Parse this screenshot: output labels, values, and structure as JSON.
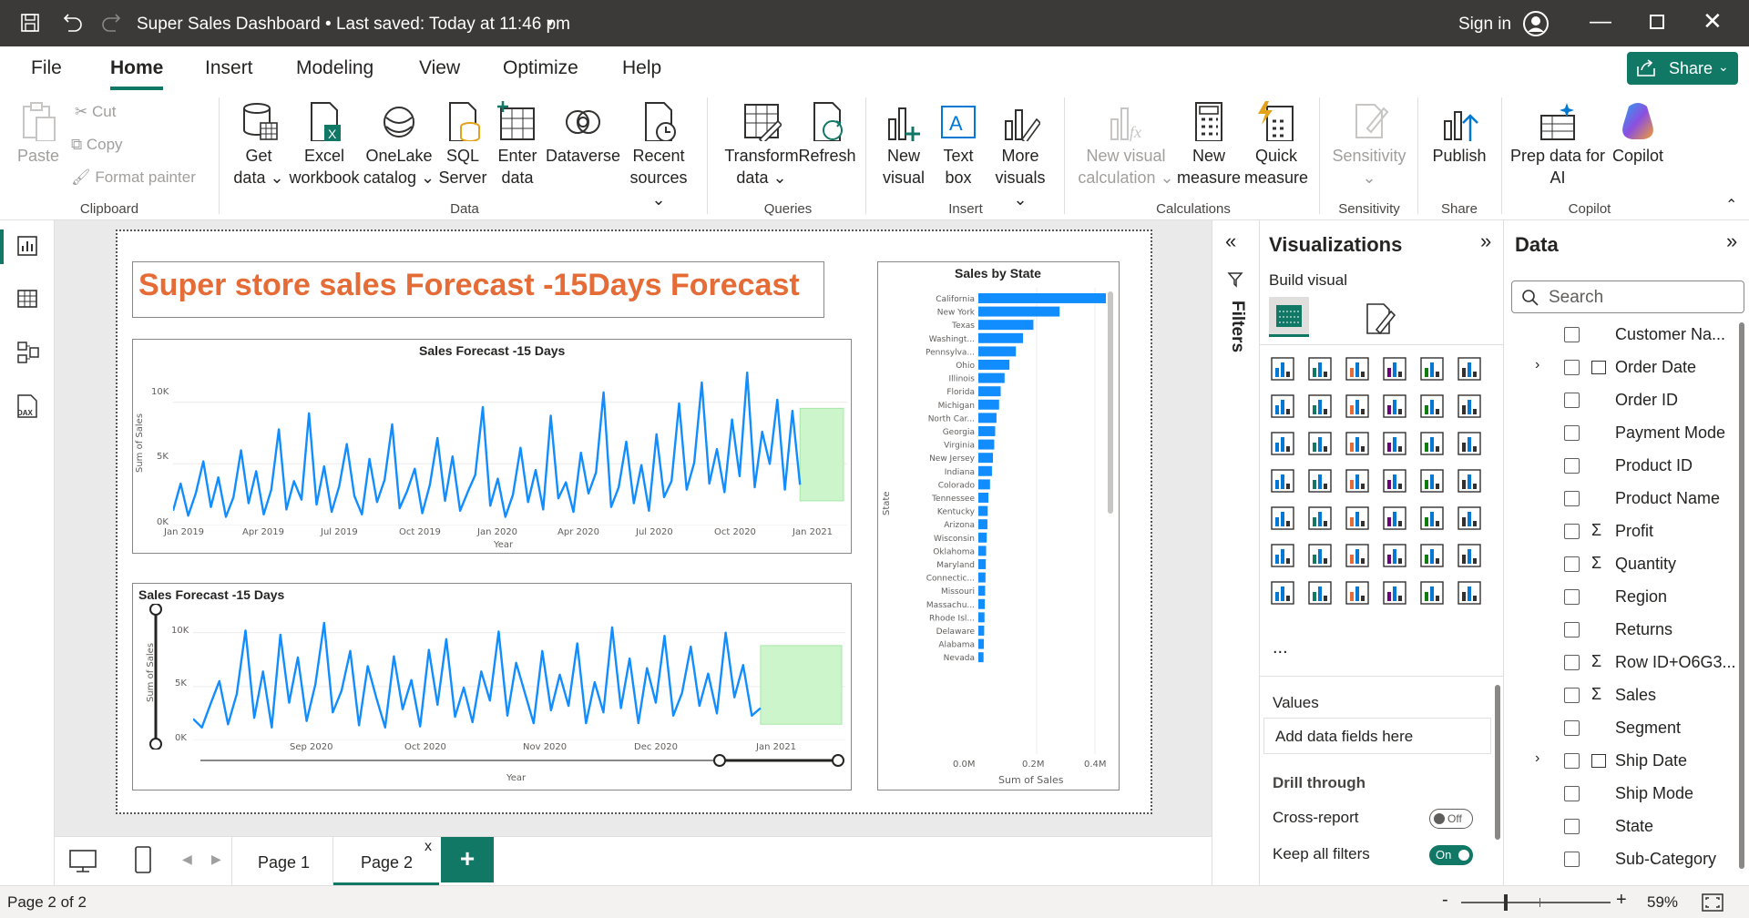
{
  "titlebar": {
    "title": "Super Sales Dashboard • Last saved: Today at 11:46 pm",
    "sign_in": "Sign in"
  },
  "menu": {
    "items": [
      "File",
      "Home",
      "Insert",
      "Modeling",
      "View",
      "Optimize",
      "Help"
    ],
    "active": "Home",
    "share_label": "Share"
  },
  "ribbon": {
    "clipboard": {
      "paste": "Paste",
      "cut": "Cut",
      "copy": "Copy",
      "format_painter": "Format painter",
      "group": "Clipboard"
    },
    "data": {
      "get_data": [
        "Get",
        "data"
      ],
      "excel": [
        "Excel",
        "workbook"
      ],
      "onelake": [
        "OneLake",
        "catalog"
      ],
      "sql": [
        "SQL",
        "Server"
      ],
      "enter": [
        "Enter",
        "data"
      ],
      "dataverse": "Dataverse",
      "recent": [
        "Recent",
        "sources"
      ],
      "group": "Data"
    },
    "queries": {
      "transform": [
        "Transform",
        "data"
      ],
      "refresh": "Refresh",
      "group": "Queries"
    },
    "insert": {
      "new_visual": [
        "New",
        "visual"
      ],
      "text_box": [
        "Text",
        "box"
      ],
      "more_visuals": [
        "More",
        "visuals"
      ],
      "group": "Insert"
    },
    "calculations": {
      "new_visual_calc": [
        "New visual",
        "calculation"
      ],
      "new_measure": [
        "New",
        "measure"
      ],
      "quick_measure": [
        "Quick",
        "measure"
      ],
      "group": "Calculations"
    },
    "sensitivity": {
      "label": "Sensitivity",
      "group": "Sensitivity"
    },
    "share": {
      "publish": "Publish",
      "group": "Share"
    },
    "copilot": {
      "prep": [
        "Prep data for",
        "AI"
      ],
      "copilot": "Copilot",
      "group": "Copilot"
    }
  },
  "report": {
    "title": "Super store sales Forecast -15Days Forecast",
    "chart1": {
      "title": "Sales Forecast -15 Days",
      "ylabel": "Sum of Sales",
      "xlabel": "Year",
      "yticks": [
        "10K",
        "5K",
        "0K"
      ],
      "xticks": [
        "Jan 2019",
        "Apr 2019",
        "Jul 2019",
        "Oct 2019",
        "Jan 2020",
        "Apr 2020",
        "Jul 2020",
        "Oct 2020",
        "Jan 2021"
      ]
    },
    "chart2": {
      "title": "Sales Forecast -15 Days",
      "ylabel": "Sum of Sales",
      "xlabel": "Year",
      "yticks": [
        "10K",
        "5K",
        "0K"
      ],
      "xticks": [
        "Sep 2020",
        "Oct 2020",
        "Nov 2020",
        "Dec 2020",
        "Jan 2021"
      ]
    },
    "chart3": {
      "title": "Sales by State",
      "ylabel": "State",
      "xlabel": "Sum of Sales",
      "xticks": [
        "0.0M",
        "0.2M",
        "0.4M"
      ]
    }
  },
  "chart_data": [
    {
      "type": "line",
      "title": "Sales Forecast -15 Days",
      "xlabel": "Year",
      "ylabel": "Sum of Sales",
      "xlim": [
        "2019-01",
        "2021-01"
      ],
      "ylim": [
        0,
        13000
      ],
      "series": [
        {
          "values": [
            1200,
            3400,
            800,
            2600,
            5200,
            1500,
            3900,
            700,
            2300,
            6100,
            1800,
            4400,
            900,
            2900,
            7800,
            1300,
            3600,
            2100,
            9100,
            1700,
            4800,
            1100,
            3200,
            6600,
            2400,
            900,
            5400,
            1900,
            3700,
            8200,
            1400,
            2800,
            4600,
            1000,
            3300,
            7100,
            2000,
            5600,
            1200,
            2700,
            4100,
            9600,
            1600,
            3800,
            700,
            2500,
            6300,
            1900,
            4500,
            1300,
            8900,
            2200,
            3500,
            1100,
            5900,
            2600,
            4300,
            10800,
            1500,
            3100,
            6800,
            1800,
            4900,
            1200,
            7400,
            2300,
            3600,
            9900,
            2900,
            5100,
            11600,
            3400,
            6200,
            2700,
            8600,
            4000,
            12400,
            3100,
            7600,
            5000,
            10200,
            2900,
            9300,
            3300
          ]
        }
      ],
      "forecast_band": {
        "from": "2021-01",
        "low": 2000,
        "high": 9500
      }
    },
    {
      "type": "line",
      "title": "Sales Forecast -15 Days",
      "xlabel": "Year",
      "ylabel": "Sum of Sales",
      "xlim": [
        "2020-08",
        "2021-01"
      ],
      "ylim": [
        0,
        12000
      ],
      "series": [
        {
          "values": [
            2000,
            1200,
            3400,
            5500,
            1500,
            4300,
            10200,
            2100,
            6400,
            1200,
            9800,
            3500,
            7700,
            1800,
            5200,
            10900,
            2600,
            4600,
            8300,
            1400,
            6900,
            3900,
            1200,
            7800,
            2900,
            5600,
            1300,
            8400,
            3300,
            9400,
            2200,
            4900,
            1700,
            6400,
            3700,
            10100,
            2300,
            7200,
            4400,
            1600,
            8300,
            2800,
            6100,
            3200,
            9000,
            1600,
            5400,
            2600,
            10500,
            3000,
            7600,
            1600,
            6700,
            3500,
            9700,
            2300,
            4400,
            8700,
            3200,
            6200,
            2500,
            10000,
            4000,
            7000,
            2300,
            3000
          ]
        }
      ],
      "forecast_band": {
        "from": "2021-01",
        "low": 1500,
        "high": 8800
      }
    },
    {
      "type": "bar",
      "orientation": "horizontal",
      "title": "Sales by State",
      "xlabel": "Sum of Sales",
      "ylabel": "State",
      "xlim": [
        0,
        0.45
      ],
      "unit": "M",
      "categories": [
        "California",
        "New York",
        "Texas",
        "Washingt...",
        "Pennsylva...",
        "Ohio",
        "Illinois",
        "Florida",
        "Michigan",
        "North Car...",
        "Georgia",
        "Virginia",
        "New Jersey",
        "Indiana",
        "Colorado",
        "Tennessee",
        "Kentucky",
        "Arizona",
        "Wisconsin",
        "Oklahoma",
        "Maryland",
        "Connectic...",
        "Missouri",
        "Massachu...",
        "Rhode Isl...",
        "Delaware",
        "Alabama",
        "Nevada"
      ],
      "values": [
        0.457,
        0.251,
        0.17,
        0.138,
        0.116,
        0.096,
        0.081,
        0.069,
        0.064,
        0.056,
        0.052,
        0.049,
        0.045,
        0.042,
        0.036,
        0.031,
        0.029,
        0.028,
        0.026,
        0.024,
        0.023,
        0.022,
        0.021,
        0.02,
        0.019,
        0.018,
        0.017,
        0.016
      ]
    }
  ],
  "filters_label": "Filters",
  "viz_pane": {
    "title": "Visualizations",
    "build_visual": "Build visual",
    "values_label": "Values",
    "add_fields": "Add data fields here",
    "drill_through": "Drill through",
    "cross_report": "Cross-report",
    "cross_report_state": "Off",
    "keep_filters": "Keep all filters",
    "keep_filters_state": "On",
    "more": "..."
  },
  "data_pane": {
    "title": "Data",
    "search_placeholder": "Search",
    "fields": [
      {
        "name": "Customer Na...",
        "type": "text",
        "expand": false
      },
      {
        "name": "Order Date",
        "type": "date",
        "expand": true
      },
      {
        "name": "Order ID",
        "type": "text",
        "expand": false
      },
      {
        "name": "Payment Mode",
        "type": "text",
        "expand": false
      },
      {
        "name": "Product ID",
        "type": "text",
        "expand": false
      },
      {
        "name": "Product Name",
        "type": "text",
        "expand": false
      },
      {
        "name": "Profit",
        "type": "sum",
        "expand": false
      },
      {
        "name": "Quantity",
        "type": "sum",
        "expand": false
      },
      {
        "name": "Region",
        "type": "text",
        "expand": false
      },
      {
        "name": "Returns",
        "type": "text",
        "expand": false
      },
      {
        "name": "Row ID+O6G3...",
        "type": "sum",
        "expand": false
      },
      {
        "name": "Sales",
        "type": "sum",
        "expand": false
      },
      {
        "name": "Segment",
        "type": "text",
        "expand": false
      },
      {
        "name": "Ship Date",
        "type": "date",
        "expand": true
      },
      {
        "name": "Ship Mode",
        "type": "text",
        "expand": false
      },
      {
        "name": "State",
        "type": "text",
        "expand": false
      },
      {
        "name": "Sub-Category",
        "type": "text",
        "expand": false
      }
    ]
  },
  "pages": {
    "tabs": [
      "Page 1",
      "Page 2"
    ],
    "active": "Page 2",
    "add": "+",
    "close": "x"
  },
  "status": {
    "page": "Page 2 of 2",
    "zoom": "59%",
    "minus": "-",
    "plus": "+"
  },
  "colors": {
    "accent": "#117865",
    "bar": "#118dff",
    "forecast": "#ccf5cc",
    "title_orange": "#e66c37"
  }
}
